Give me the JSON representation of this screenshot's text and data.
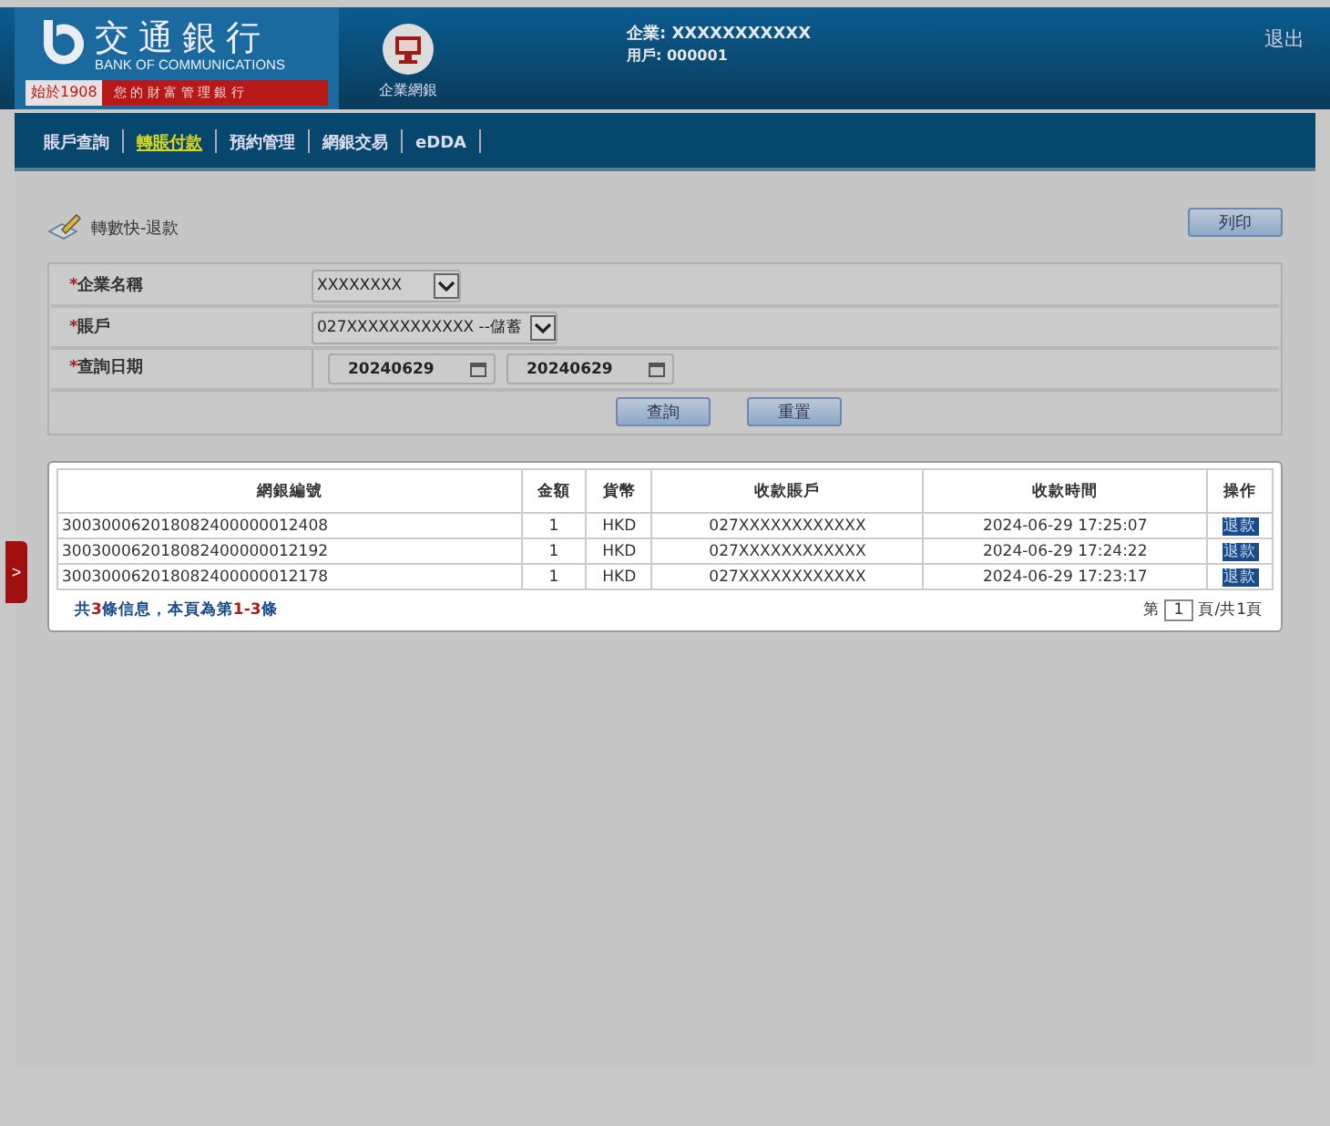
{
  "header": {
    "bank_name": "交通銀行",
    "bank_name_en": "BANK OF COMMUNICATIONS",
    "since": "始於1908",
    "slogan": "您 的 財 富 管 理 銀 行",
    "portal_label": "企業網銀",
    "company_line": "企業: XXXXXXXXXXX",
    "user_line": "用戶: 000001",
    "logout": "退出"
  },
  "nav": [
    {
      "label": "賬戶查詢",
      "selected": false
    },
    {
      "label": "轉賬付款",
      "selected": true
    },
    {
      "label": "預約管理",
      "selected": false
    },
    {
      "label": "網銀交易",
      "selected": false
    },
    {
      "label": "eDDA",
      "selected": false
    }
  ],
  "page_title": "轉數快-退款",
  "print_button": "列印",
  "form": {
    "company_mark": "*",
    "account_mark": "*",
    "date_mark": "*",
    "company_label": "企業名稱",
    "company_value": "XXXXXXXX",
    "account_label": "賬戶",
    "account_value": "027XXXXXXXXXXXX --儲蓄",
    "date_label": "查詢日期",
    "date_from": "20240629",
    "date_to": "20240629",
    "query_button": "查詢",
    "reset_button": "重置"
  },
  "table": {
    "columns": [
      "網銀編號",
      "金額",
      "貨幣",
      "收款賬戶",
      "收款時間",
      "操作"
    ],
    "rows": [
      [
        "300300062018082400000012408",
        "1",
        "HKD",
        "027XXXXXXXXXXXX",
        "2024-06-29 17:25:07",
        "退款"
      ],
      [
        "300300062018082400000012192",
        "1",
        "HKD",
        "027XXXXXXXXXXXX",
        "2024-06-29 17:24:22",
        "退款"
      ],
      [
        "300300062018082400000012178",
        "1",
        "HKD",
        "027XXXXXXXXXXXX",
        "2024-06-29 17:23:17",
        "退款"
      ]
    ]
  },
  "summary": [
    {
      "text": "共",
      "emphasis": false
    },
    {
      "text": "3",
      "emphasis": true
    },
    {
      "text": "條信息，本頁為第",
      "emphasis": false
    },
    {
      "text": "1-3",
      "emphasis": true
    },
    {
      "text": "條",
      "emphasis": false
    }
  ],
  "pager": {
    "prefix": "第",
    "page": "1",
    "suffix": "頁/共1頁"
  },
  "side_toggle": ">"
}
